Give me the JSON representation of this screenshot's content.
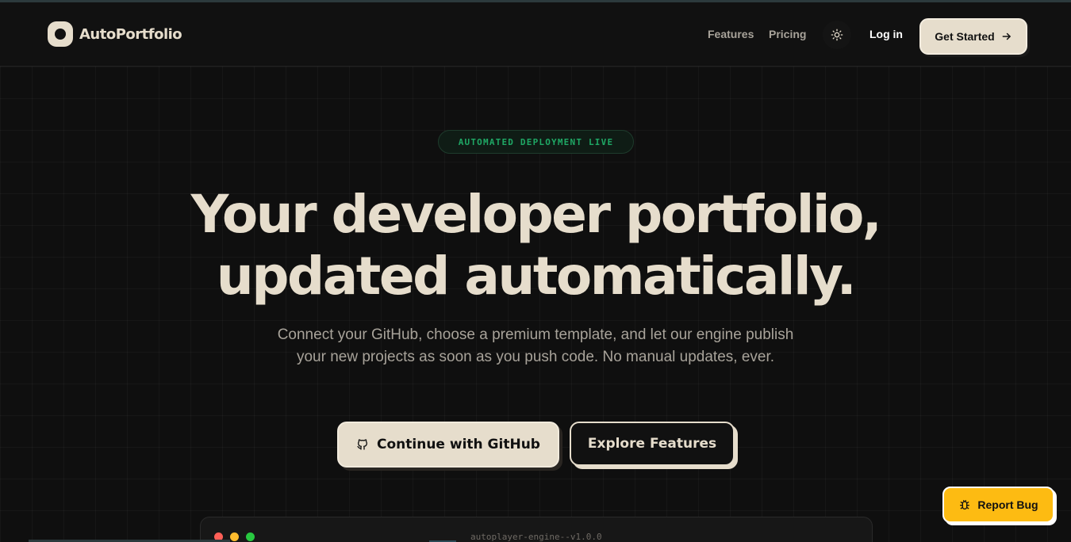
{
  "brand": {
    "name": "AutoPortfolio"
  },
  "nav": {
    "features": "Features",
    "pricing": "Pricing",
    "login": "Log in",
    "cta": "Get Started",
    "theme_icon": "sun-icon"
  },
  "hero": {
    "badge": "AUTOMATED DEPLOYMENT LIVE",
    "title_line1": "Your developer portfolio,",
    "title_line2": "updated automatically.",
    "subtitle": "Connect your GitHub, choose a premium template, and let our engine publish your new projects as soon as you push code. No manual updates, ever.",
    "primary_button": "Continue with GitHub",
    "secondary_button": "Explore Features"
  },
  "terminal": {
    "title": "autoplayer-engine--v1.0.0"
  },
  "report": {
    "label": "Report Bug"
  },
  "colors": {
    "background": "#0f0f0f",
    "cream": "#e6ddcc",
    "accent_green": "#1fa865",
    "report_yellow": "#fdbb12"
  }
}
